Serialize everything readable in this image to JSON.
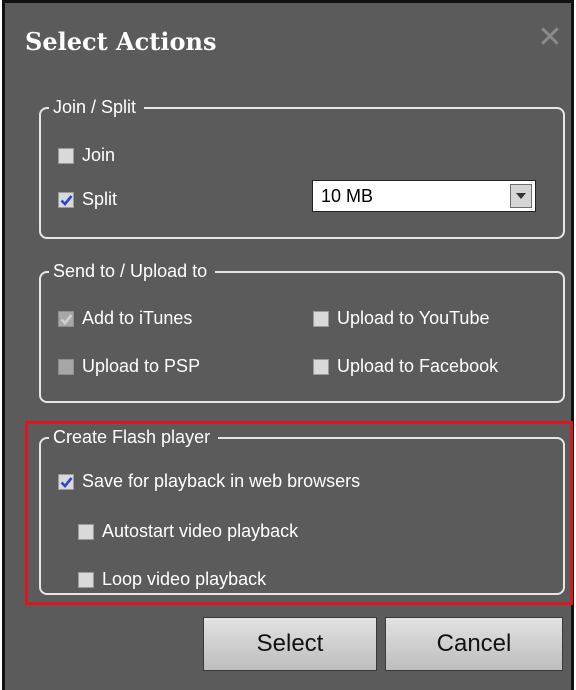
{
  "dialog": {
    "title": "Select Actions",
    "close_icon": "close-icon"
  },
  "join_split": {
    "legend": "Join / Split",
    "join": {
      "label": "Join",
      "checked": false
    },
    "split": {
      "label": "Split",
      "checked": true
    },
    "split_size": {
      "value": "10 MB"
    }
  },
  "send_upload": {
    "legend": "Send to / Upload to",
    "add_itunes": {
      "label": "Add to iTunes",
      "checked": true,
      "disabled": true
    },
    "upload_youtube": {
      "label": "Upload to YouTube",
      "checked": false
    },
    "upload_psp": {
      "label": "Upload to PSP",
      "checked": false,
      "disabled": true
    },
    "upload_facebook": {
      "label": "Upload to Facebook",
      "checked": false
    }
  },
  "flash_player": {
    "legend": "Create Flash player",
    "save_web": {
      "label": "Save for playback in web browsers",
      "checked": true
    },
    "autostart": {
      "label": "Autostart video playback",
      "checked": false
    },
    "loop": {
      "label": "Loop video playback",
      "checked": false
    },
    "highlight_color": "#e0141e"
  },
  "buttons": {
    "select": "Select",
    "cancel": "Cancel"
  },
  "colors": {
    "background": "#5b5b5b",
    "text": "#ffffff",
    "checkmark": "#2a47c8"
  }
}
